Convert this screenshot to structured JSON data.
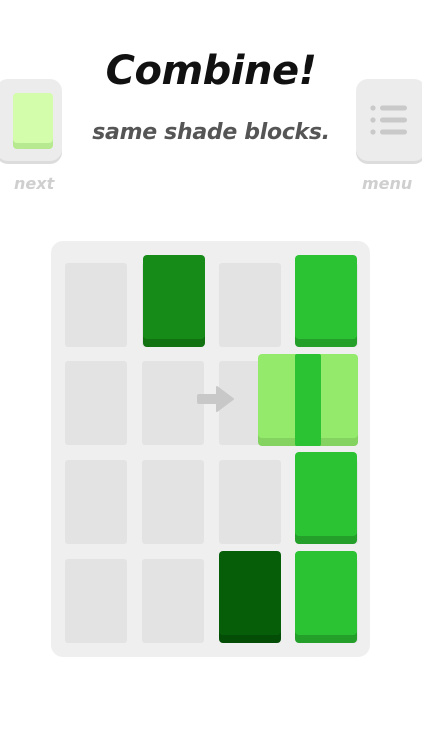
{
  "header": {
    "title": "Combine!",
    "subtitle": "same shade blocks."
  },
  "next": {
    "label": "next",
    "block_color": "#d3fcab"
  },
  "menu": {
    "label": "menu",
    "icon": "list-icon"
  },
  "board": {
    "rows": 4,
    "cols": 4,
    "colors": {
      "board": "#efefef",
      "empty_cell": "#e3e3e3",
      "medium_green": "#2bc334",
      "dark_green": "#168b17",
      "darkest_green": "#065e09",
      "light_green": "#93ea6b",
      "hint_arrow": "#c8c8c8"
    },
    "blocks": [
      {
        "col": 1,
        "row": 0,
        "color": "#168b17",
        "shade": "dark green"
      },
      {
        "col": 3,
        "row": 0,
        "color": "#2bc334",
        "shade": "medium green"
      },
      {
        "col": 3,
        "row": 2,
        "color": "#2bc334",
        "shade": "medium green"
      },
      {
        "col": 3,
        "row": 3,
        "color": "#2bc334",
        "shade": "medium green"
      },
      {
        "col": 2,
        "row": 3,
        "color": "#065e09",
        "shade": "darkest green"
      }
    ],
    "merge_hint": {
      "row": 1,
      "from_col": 2,
      "to_col": 3,
      "color": "#93ea6b",
      "arrow_icon": "arrow-right-icon"
    }
  }
}
